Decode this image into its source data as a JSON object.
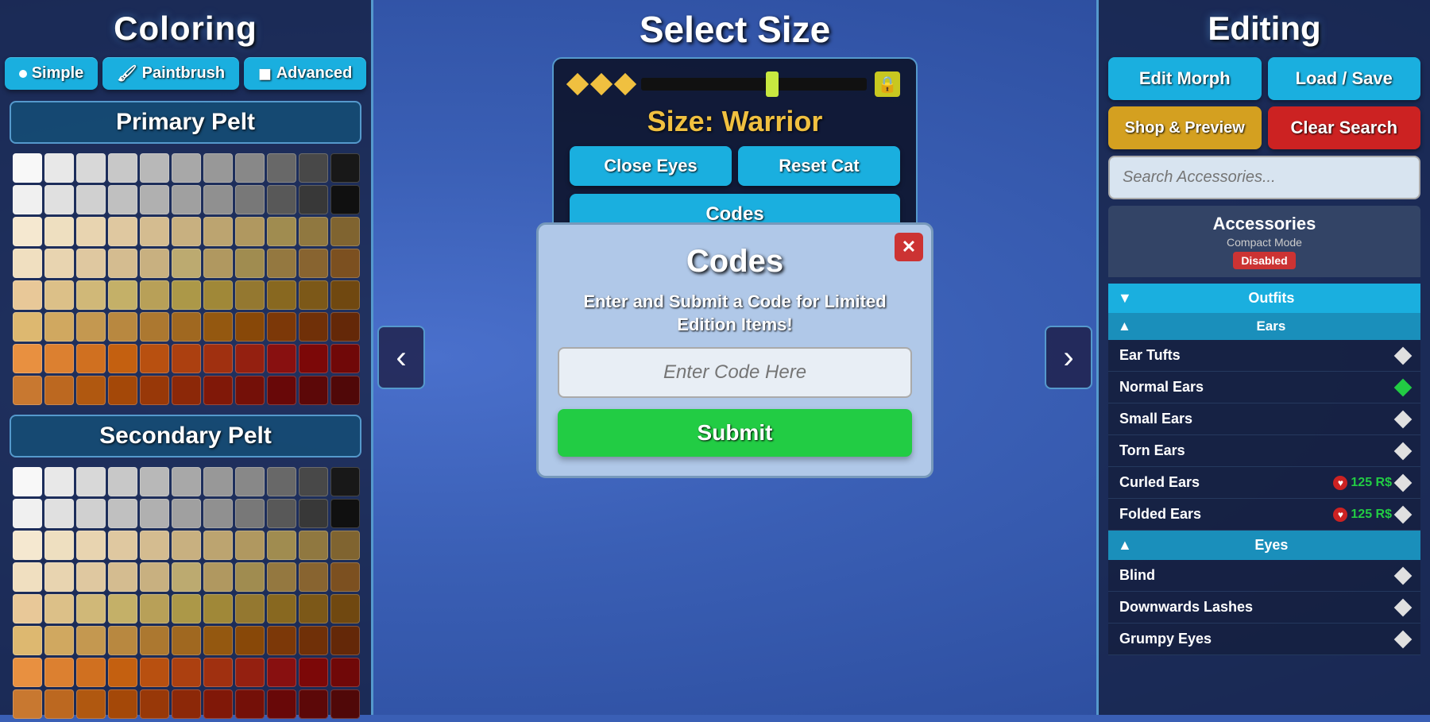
{
  "left": {
    "title": "Coloring",
    "modes": [
      {
        "label": "Simple",
        "icon": "●",
        "active": true
      },
      {
        "label": "Paintbrush",
        "icon": "🖌",
        "active": false
      },
      {
        "label": "Advanced",
        "icon": "◼",
        "active": false
      }
    ],
    "primary_pelt_label": "Primary Pelt",
    "secondary_pelt_label": "Secondary Pelt"
  },
  "center": {
    "select_size_title": "Select Size",
    "size_label": "Size: Warrior",
    "close_eyes_btn": "Close Eyes",
    "reset_cat_btn": "Reset Cat",
    "codes_btn": "Codes",
    "chevron": "^"
  },
  "modal": {
    "title": "Codes",
    "description": "Enter and Submit a Code for Limited Edition Items!",
    "input_placeholder": "Enter Code Here",
    "submit_btn": "Submit",
    "close_btn": "✕"
  },
  "right": {
    "title": "Editing",
    "edit_morph_btn": "Edit Morph",
    "load_save_btn": "Load / Save",
    "shop_preview_btn": "Shop & Preview",
    "clear_search_btn": "Clear Search",
    "search_placeholder": "Search Accessories...",
    "accessories_label": "Accessories",
    "compact_mode_label": "Compact Mode",
    "compact_mode_badge": "Disabled",
    "categories": [
      {
        "name": "Outfits",
        "expanded": true,
        "sub_categories": [
          {
            "name": "Ears",
            "items": [
              {
                "name": "Ear Tufts",
                "active": false,
                "price": null
              },
              {
                "name": "Normal Ears",
                "active": true,
                "price": null
              },
              {
                "name": "Small Ears",
                "active": false,
                "price": null
              },
              {
                "name": "Torn Ears",
                "active": false,
                "price": null
              },
              {
                "name": "Curled Ears",
                "active": false,
                "price": "125 R$"
              },
              {
                "name": "Folded Ears",
                "active": false,
                "price": "125 R$"
              }
            ]
          },
          {
            "name": "Eyes",
            "items": [
              {
                "name": "Blind",
                "active": false,
                "price": null
              },
              {
                "name": "Downwards Lashes",
                "active": false,
                "price": null
              },
              {
                "name": "Grumpy Eyes",
                "active": false,
                "price": null
              }
            ]
          }
        ]
      }
    ]
  }
}
